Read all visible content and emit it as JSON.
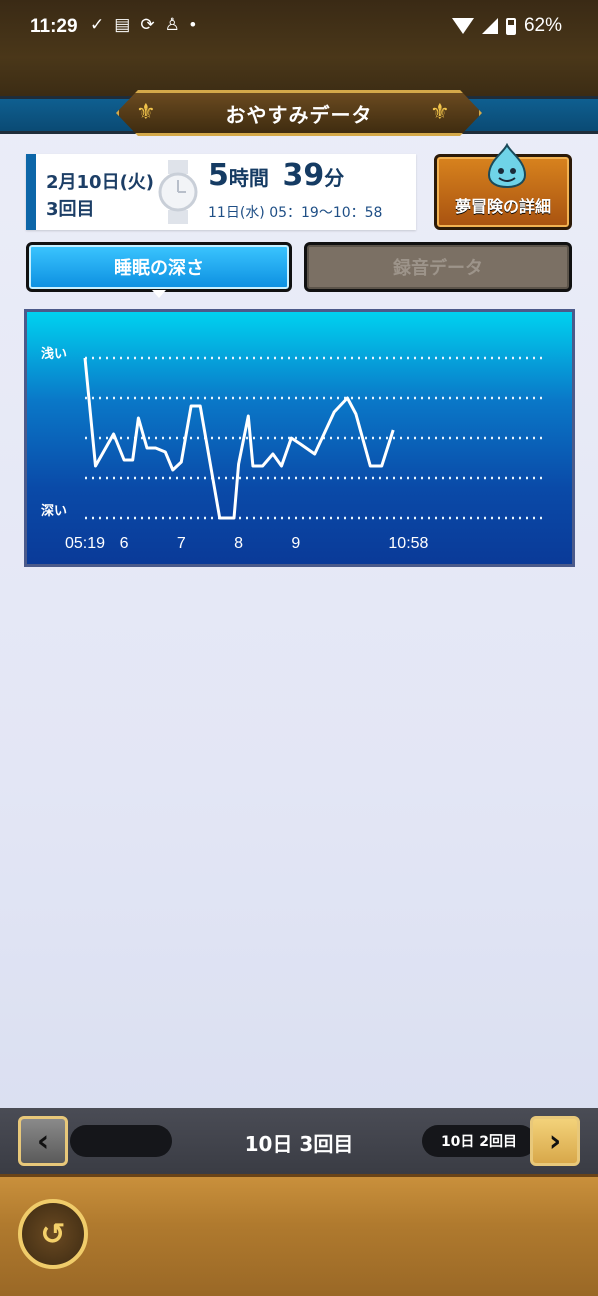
{
  "status_bar": {
    "time": "11:29",
    "battery": "62%",
    "icons": [
      "check-circle-icon",
      "notification-icon",
      "sync-icon",
      "app-icon",
      "dot-icon"
    ]
  },
  "header": {
    "title": "おやすみデータ"
  },
  "session": {
    "date": "2月10日(火)",
    "count": "3回目",
    "hours": "5",
    "hours_unit": "時間",
    "minutes": "39",
    "minutes_unit": "分",
    "range": "11日(水) 05：19～10：58"
  },
  "adventure_button": {
    "label": "夢冒険の詳細"
  },
  "tabs": [
    {
      "label": "睡眠の深さ",
      "active": true
    },
    {
      "label": "録音データ",
      "active": false
    }
  ],
  "chart_data": {
    "type": "line",
    "title": "",
    "ylabel_top": "浅い",
    "ylabel_bottom": "深い",
    "x_tick_labels": [
      "05:19",
      "6",
      "7",
      "8",
      "9",
      "10:58"
    ],
    "x_ticks_hours": [
      5.317,
      6,
      7,
      8,
      9,
      10.967
    ],
    "ylim": [
      0,
      4
    ],
    "grid": true,
    "series": [
      {
        "x": [
          5.317,
          5.5,
          5.817,
          6.0,
          6.15,
          6.25,
          6.4,
          6.55,
          6.72,
          6.85,
          7.0,
          7.17,
          7.33,
          7.67,
          7.92,
          8.0,
          8.17,
          8.25,
          8.42,
          8.6,
          8.75,
          8.92,
          9.08,
          9.33,
          9.67,
          9.9,
          10.05,
          10.3,
          10.5,
          10.7
        ],
        "y": [
          4.0,
          1.3,
          2.1,
          1.45,
          1.45,
          2.5,
          1.75,
          1.75,
          1.65,
          1.2,
          1.4,
          2.8,
          2.8,
          0.0,
          0.0,
          1.35,
          2.55,
          1.3,
          1.3,
          1.6,
          1.3,
          2.0,
          1.85,
          1.6,
          2.65,
          3.0,
          2.6,
          1.3,
          1.3,
          2.2
        ]
      }
    ]
  },
  "nav": {
    "prev_icon": "chevron-left-icon",
    "next_icon": "chevron-right-icon",
    "current": "10日 3回目",
    "next_label": "10日 2回目"
  },
  "back_button": {
    "icon": "back-arrow-icon"
  }
}
